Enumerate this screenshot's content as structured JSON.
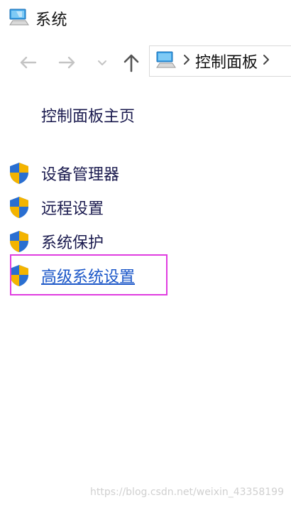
{
  "window": {
    "title": "系统",
    "title_icon": "computer-icon"
  },
  "nav": {
    "back_icon": "arrow-left-icon",
    "forward_icon": "arrow-right-icon",
    "recent_icon": "chevron-down-icon",
    "up_icon": "arrow-up-icon",
    "address": {
      "location_icon": "computer-icon",
      "crumbs": [
        "控制面板"
      ]
    }
  },
  "sidebar": {
    "home_link": "控制面板主页",
    "items": [
      {
        "label": "设备管理器",
        "icon": "uac-shield-icon",
        "active": false
      },
      {
        "label": "远程设置",
        "icon": "uac-shield-icon",
        "active": false
      },
      {
        "label": "系统保护",
        "icon": "uac-shield-icon",
        "active": false
      },
      {
        "label": "高级系统设置",
        "icon": "uac-shield-icon",
        "active": true
      }
    ]
  },
  "annotation": {
    "highlight_color": "#e03ce0"
  },
  "watermark": "https://blog.csdn.net/weixin_43358199",
  "colors": {
    "link": "#1a1a4e",
    "active_link": "#1a56c8",
    "shield_blue": "#2a6fd1",
    "shield_yellow": "#f4b400"
  }
}
